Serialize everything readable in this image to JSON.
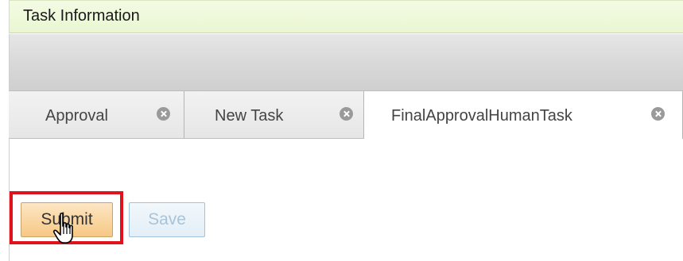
{
  "header": {
    "title": "Task Information"
  },
  "tabs": [
    {
      "label": "Approval",
      "active": false,
      "close_icon": "close-circle-icon"
    },
    {
      "label": "New Task",
      "active": false,
      "close_icon": "close-circle-icon"
    },
    {
      "label": "FinalApprovalHumanTask",
      "active": true,
      "close_icon": "close-circle-icon"
    }
  ],
  "actions": {
    "submit_label": "Submit",
    "save_label": "Save",
    "save_enabled": false
  },
  "pointer": {
    "icon": "hand-pointer-icon"
  },
  "colors": {
    "header_bg": "#eaf6d2",
    "highlight": "#e0121c",
    "submit_bg": "#f7c884",
    "save_border": "#9ec3dc"
  }
}
